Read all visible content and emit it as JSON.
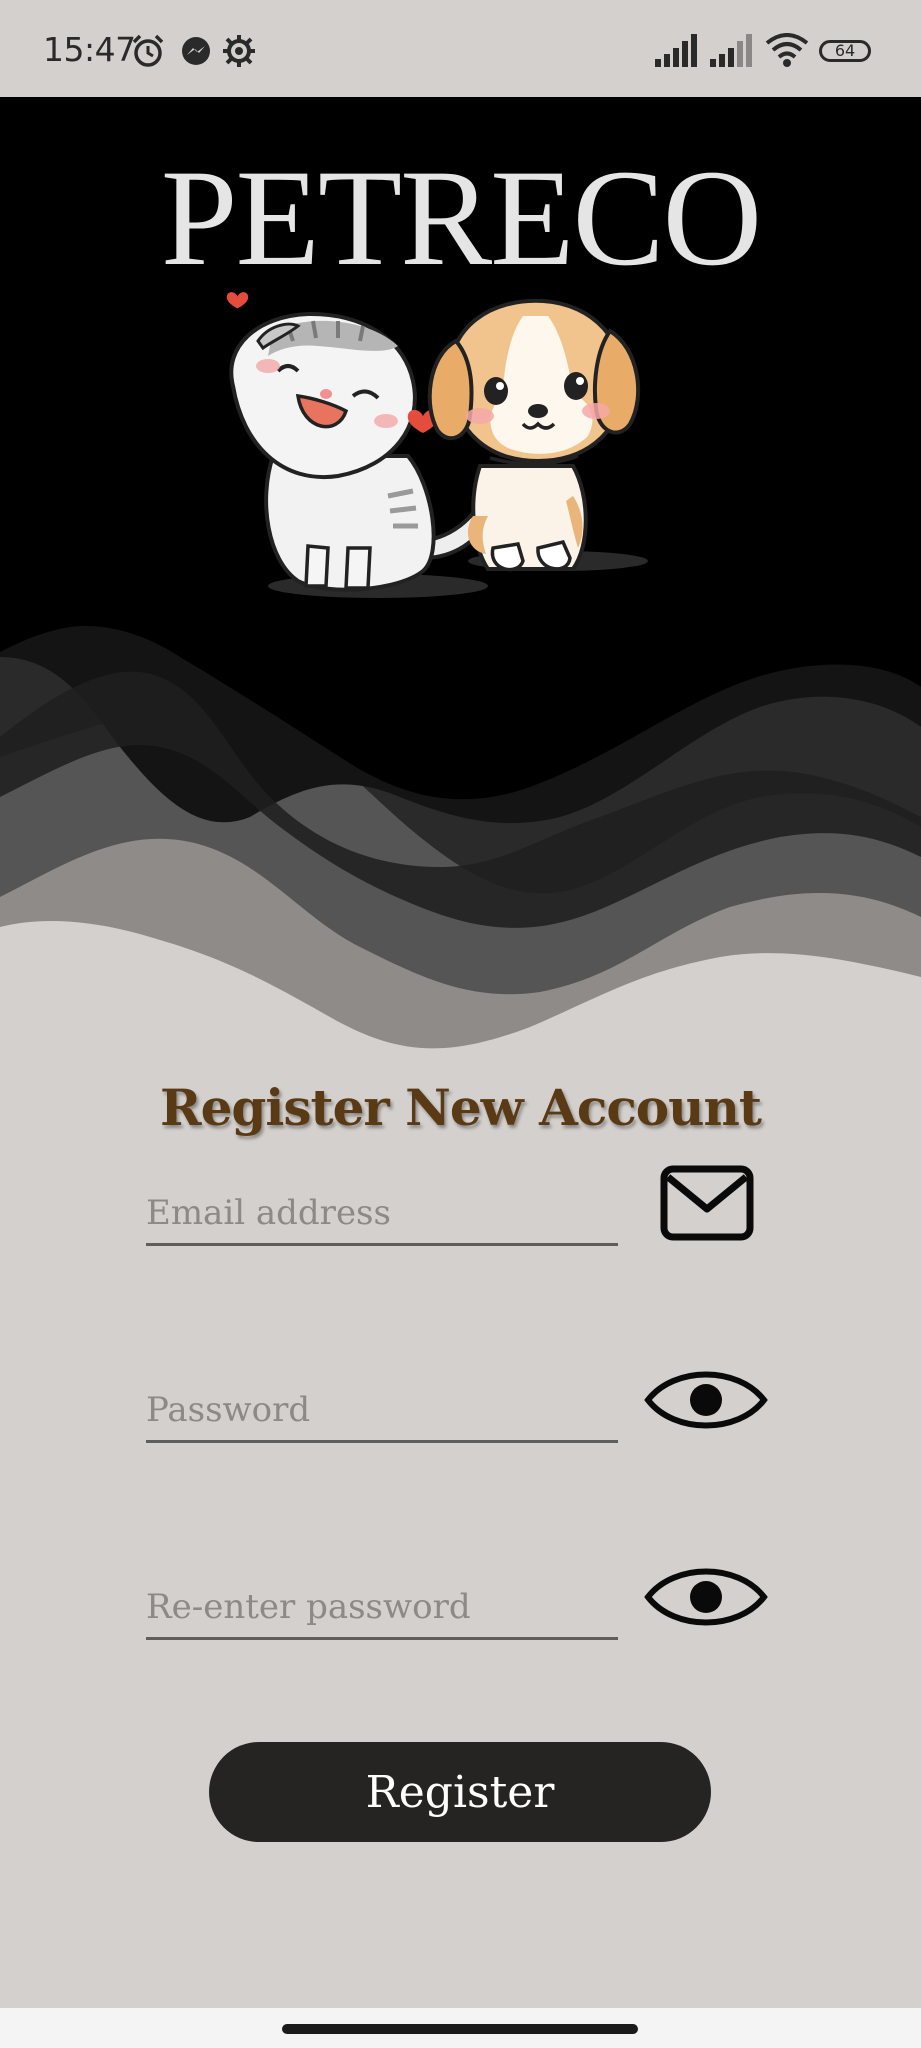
{
  "status_bar": {
    "time": "15:47",
    "battery": "64",
    "icons": [
      "alarm-icon",
      "messenger-icon",
      "settings-icon",
      "signal-icon",
      "signal-icon",
      "wifi-icon",
      "battery-icon"
    ]
  },
  "hero": {
    "brand": "PETRECO",
    "illustration": "cat-and-dog-illustration"
  },
  "form": {
    "title": "Register New Account",
    "email_placeholder": "Email address",
    "password_placeholder": "Password",
    "repassword_placeholder": "Re-enter password",
    "register_label": "Register"
  },
  "colors": {
    "background": "#d3d0cd",
    "hero": "#000000",
    "title": "#5a3a14",
    "button": "#252423"
  }
}
